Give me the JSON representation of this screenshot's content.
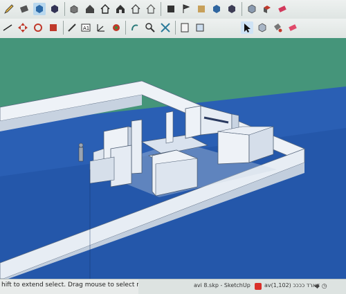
{
  "status_bar": {
    "hint": "hift to extend select. Drag mouse to select multiple."
  },
  "taskbar": {
    "window_title": "avi 8.skp - SketchUp",
    "hebrew_item": "av(1,102) זוארד ככככ"
  },
  "toolbar_icons_row1": [
    "pencil-icon",
    "eraser-icon",
    "box-icon",
    "cube-icon",
    "selected-cube-icon",
    "iso-view-icon",
    "home-icon",
    "house-outline-icon",
    "house-icon",
    "house-2-icon",
    "folder-icon",
    "flag-icon",
    "gradient-icon",
    "x-ray-icon",
    "cube-style-icon",
    "pointer-icon",
    "components-icon",
    "paint-icon",
    "eraser-tool-icon"
  ],
  "toolbar_icons_row2": [
    "scale-icon",
    "move-icon",
    "rotate-icon",
    "follow-me-icon",
    "tape-measure-icon",
    "text-icon",
    "dimension-icon",
    "axes-icon",
    "orbit-icon",
    "pan-icon",
    "zoom-icon",
    "zoom-extents-icon",
    "section-icon",
    "push-pull-icon"
  ],
  "colors": {
    "sky": "#3f8f74",
    "ground": "#1f4fa5",
    "wall_top": "#e9eef3",
    "wall_side": "#c9d3e0",
    "floor": "#d3dce8",
    "statusbar": "#e8ebea"
  }
}
